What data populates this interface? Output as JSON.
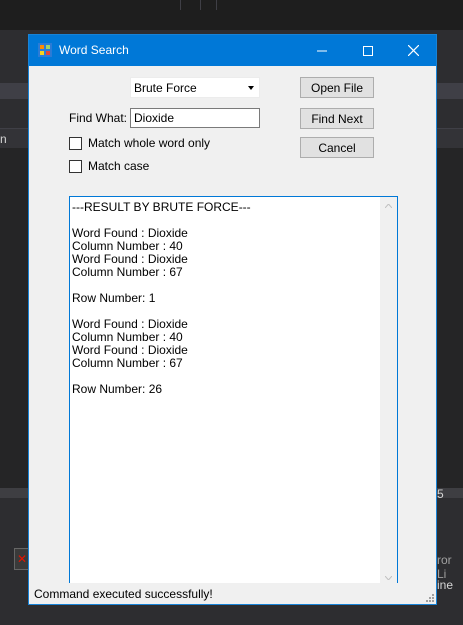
{
  "background": {
    "left_tab_text": "n",
    "side_number": "5",
    "error_list_fragment": "ror Li",
    "line_fragment": "ine"
  },
  "dialog": {
    "title": "Word Search",
    "algorithm_select": {
      "value": "Brute Force"
    },
    "find_label": "Find What:",
    "find_input": {
      "value": "Dioxide"
    },
    "match_whole_word": {
      "label": "Match whole word only",
      "checked": false
    },
    "match_case": {
      "label": "Match case",
      "checked": false
    },
    "buttons": {
      "open_file": "Open File",
      "find_next": "Find Next",
      "cancel": "Cancel"
    },
    "result_text": "---RESULT BY BRUTE FORCE---\n\nWord Found : Dioxide\nColumn Number : 40\nWord Found : Dioxide\nColumn Number : 67\n\nRow Number: 1\n\nWord Found : Dioxide\nColumn Number : 40\nWord Found : Dioxide\nColumn Number : 67\n\nRow Number: 26",
    "status": "Command executed successfully!"
  },
  "colors": {
    "titlebar": "#0078d7",
    "window_bg": "#f0f0f0",
    "ide_bg": "#2d2d30"
  }
}
